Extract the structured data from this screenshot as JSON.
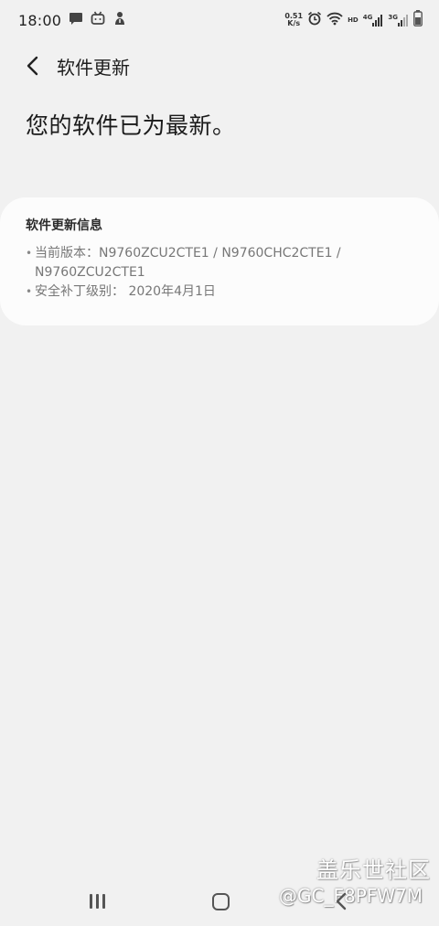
{
  "status_bar": {
    "time": "18:00",
    "net_speed_value": "0.51",
    "net_speed_unit": "K/s",
    "hd_label": "HD",
    "sim1_type": "4G",
    "sim2_type": "3G"
  },
  "header": {
    "title": "软件更新"
  },
  "main": {
    "headline": "您的软件已为最新。"
  },
  "info_card": {
    "title": "软件更新信息",
    "items": [
      {
        "bullet": "•",
        "text": "当前版本：N9760ZCU2CTE1 / N9760CHC2CTE1 / N9760ZCU2CTE1"
      },
      {
        "bullet": "•",
        "text": "安全补丁级别： 2020年4月1日"
      }
    ]
  },
  "watermark": {
    "site": "盖乐世社区",
    "user": "@GC_F8PFW7M"
  },
  "colors": {
    "background": "#f1f1f1",
    "card": "#fcfcfc",
    "primary_text": "#1d1d1d",
    "secondary_text": "#777777"
  },
  "icons": [
    "message-icon",
    "bilibili-icon",
    "download-app-icon",
    "alarm-icon",
    "wifi-icon",
    "signal-icon",
    "battery-icon",
    "back-arrow-icon",
    "nav-recents-icon",
    "nav-home-icon",
    "nav-back-icon"
  ]
}
